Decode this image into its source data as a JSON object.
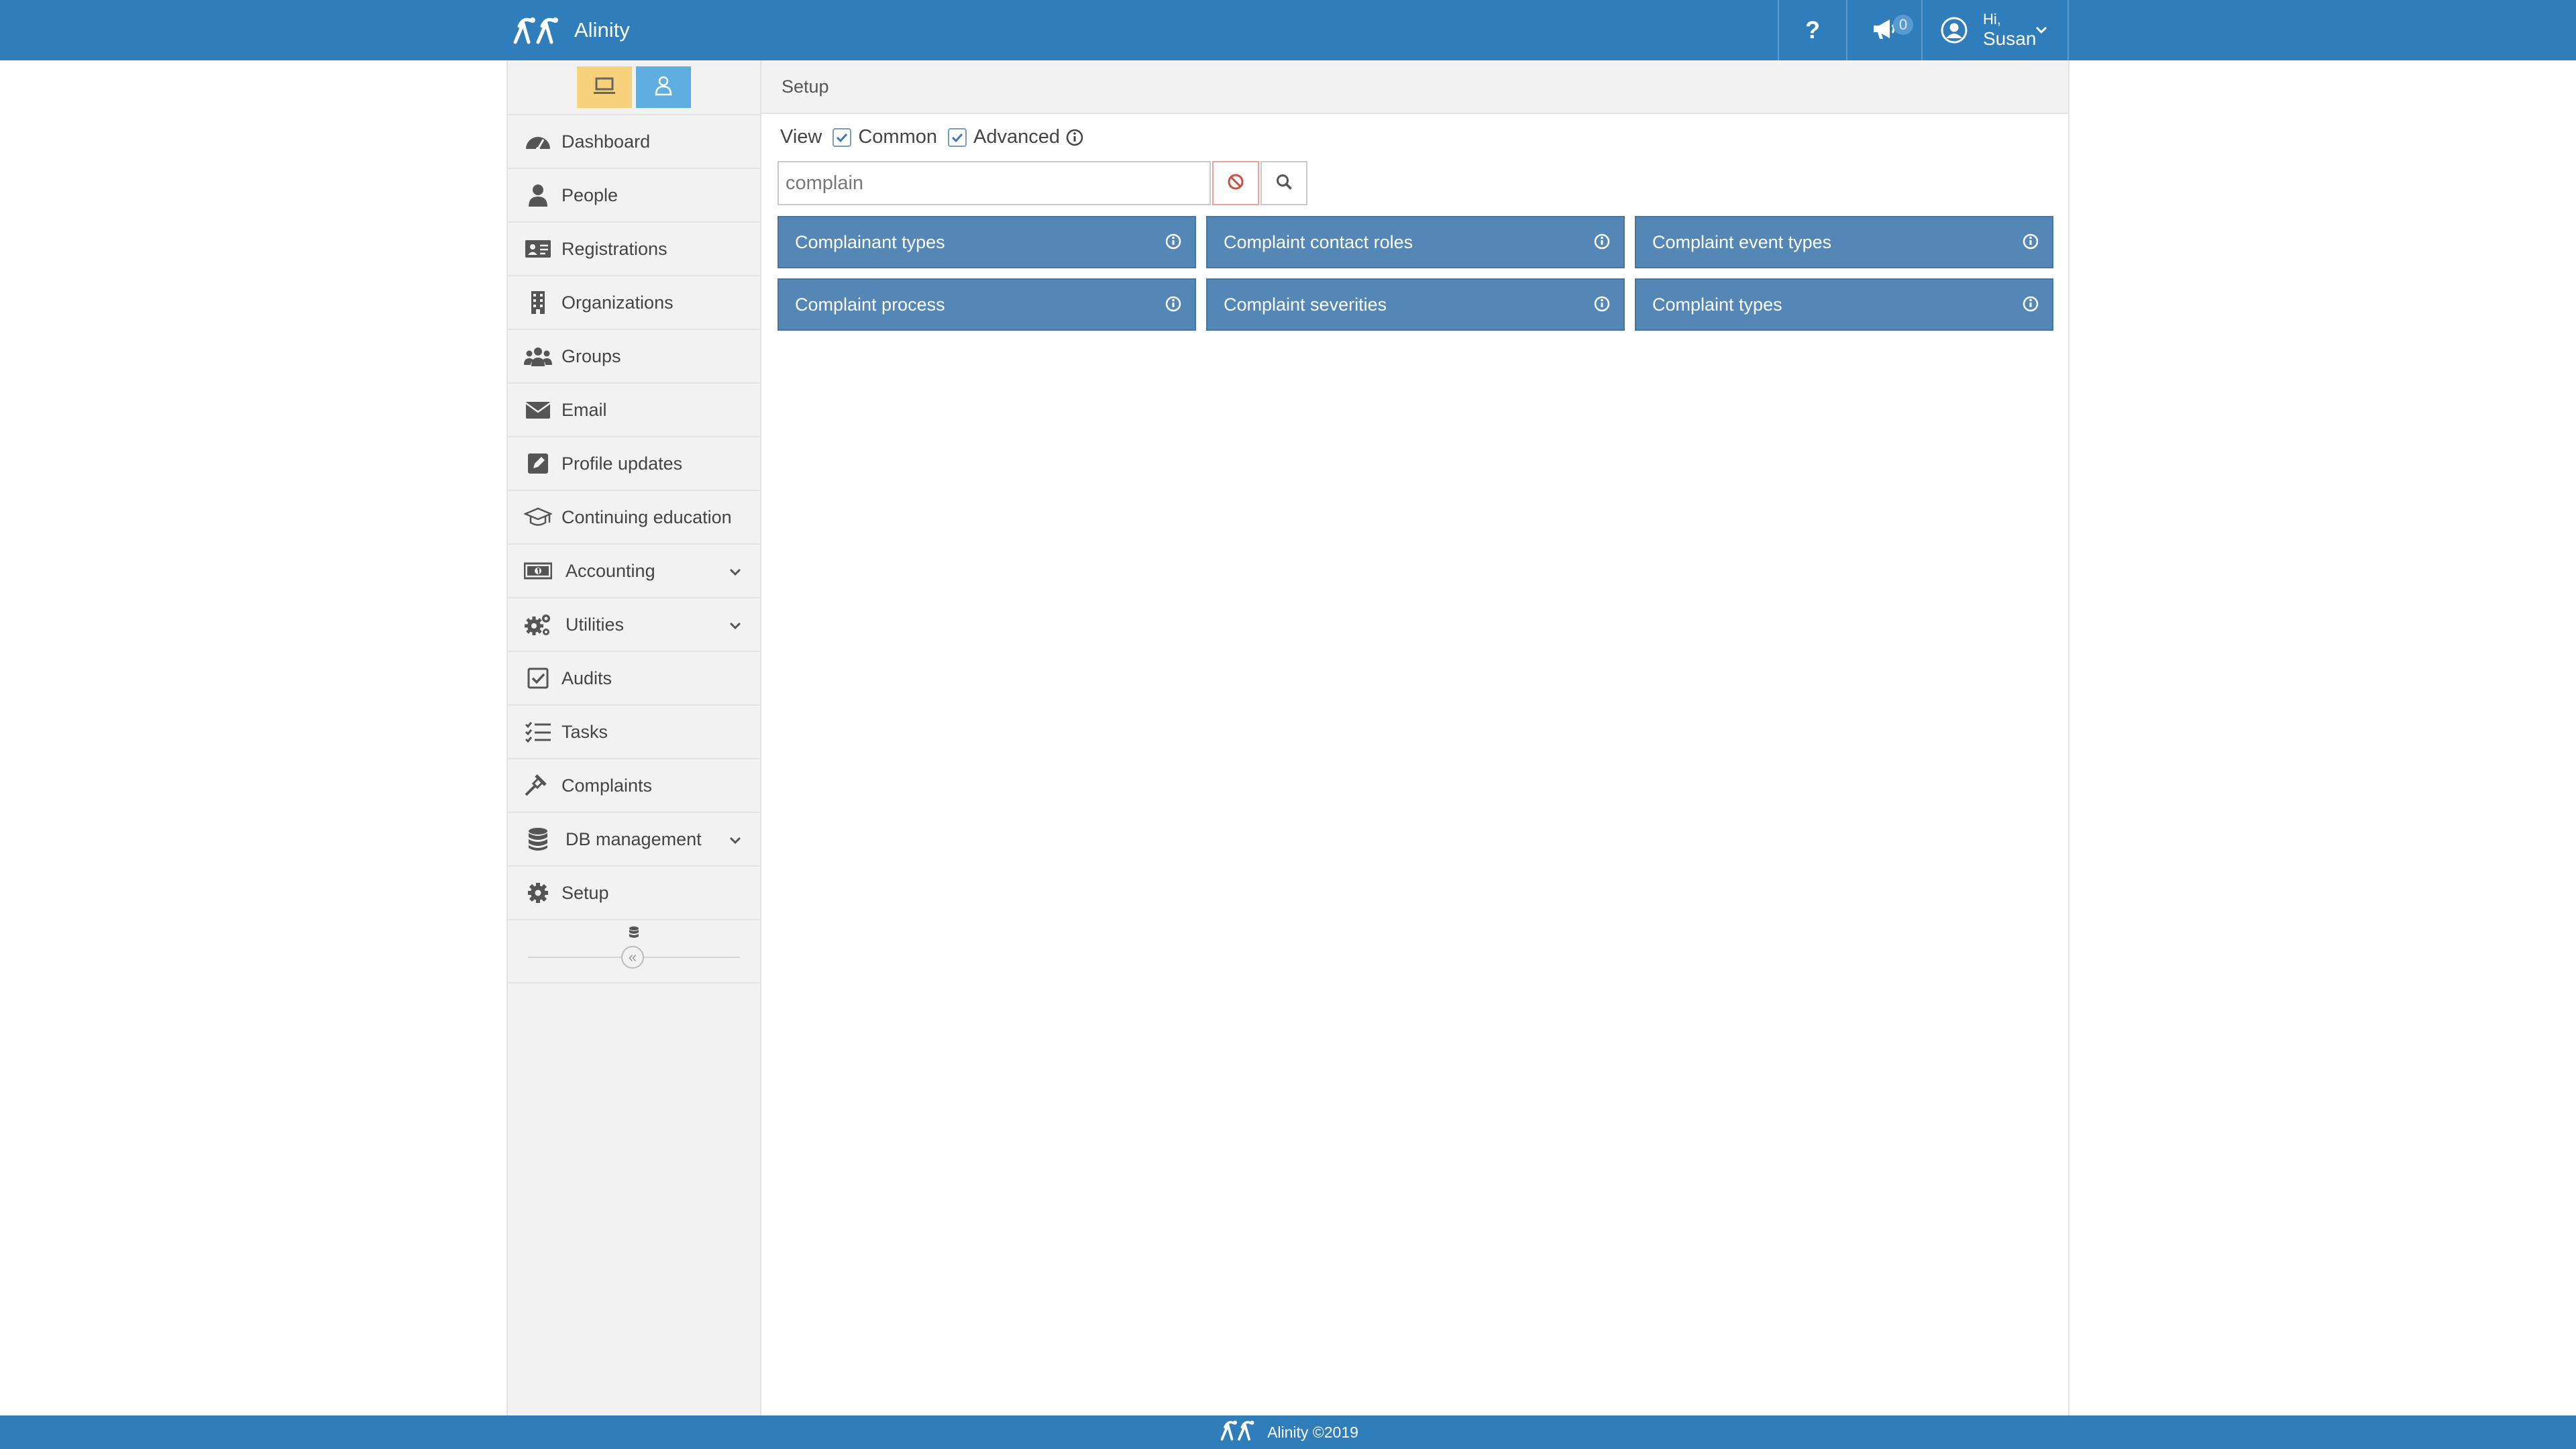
{
  "app": {
    "name": "Alinity",
    "brand_color": "#2f7ebb",
    "logo_icon": "alinity-logo-icon"
  },
  "topnav": {
    "help_label": "?",
    "announcements_icon": "megaphone-icon",
    "announcements_count": "0",
    "user_icon": "user-circle-icon",
    "user_greeting": "Hi,",
    "user_name": "Susan"
  },
  "sidebar": {
    "mode_toggle": [
      {
        "icon": "laptop-icon",
        "color": "#f8d27a"
      },
      {
        "icon": "person-icon",
        "color": "#5eaee2"
      }
    ],
    "items": [
      {
        "label": "Dashboard",
        "icon": "tachometer-icon"
      },
      {
        "label": "People",
        "icon": "user-icon"
      },
      {
        "label": "Registrations",
        "icon": "id-card-icon"
      },
      {
        "label": "Organizations",
        "icon": "building-icon"
      },
      {
        "label": "Groups",
        "icon": "users-icon"
      },
      {
        "label": "Email",
        "icon": "envelope-icon"
      },
      {
        "label": "Profile updates",
        "icon": "edit-icon"
      },
      {
        "label": "Continuing education",
        "icon": "graduation-cap-icon"
      },
      {
        "label": "Accounting",
        "icon": "money-bill-icon",
        "expandable": true
      },
      {
        "label": "Utilities",
        "icon": "cogs-icon",
        "expandable": true
      },
      {
        "label": "Audits",
        "icon": "check-square-icon"
      },
      {
        "label": "Tasks",
        "icon": "tasks-icon"
      },
      {
        "label": "Complaints",
        "icon": "gavel-icon"
      },
      {
        "label": "DB management",
        "icon": "database-icon",
        "expandable": true
      },
      {
        "label": "Setup",
        "icon": "cog-icon"
      }
    ],
    "collapse_label": "«"
  },
  "main": {
    "breadcrumb": "Setup",
    "view_label": "View",
    "filters": [
      {
        "label": "Common",
        "checked": true
      },
      {
        "label": "Advanced",
        "checked": true
      }
    ],
    "search": {
      "value": "complain",
      "placeholder": ""
    },
    "tiles": [
      {
        "label": "Complainant types"
      },
      {
        "label": "Complaint contact roles"
      },
      {
        "label": "Complaint event types"
      },
      {
        "label": "Complaint process"
      },
      {
        "label": "Complaint severities"
      },
      {
        "label": "Complaint types"
      }
    ],
    "tile_color": "#5487b6"
  },
  "footer": {
    "text": "Alinity ©2019"
  }
}
